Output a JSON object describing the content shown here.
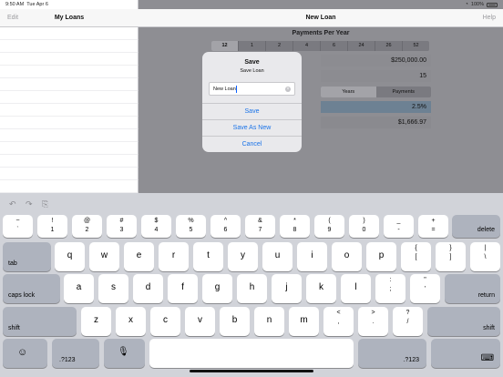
{
  "status_bar": {
    "time": "9:50 AM",
    "date": "Tue Apr 6",
    "battery": "100%"
  },
  "master": {
    "edit": "Edit",
    "title": "My Loans"
  },
  "detail": {
    "title": "New Loan",
    "help": "Help",
    "payments_per_year_label": "Payments Per Year",
    "payments_per_year_options": [
      "12",
      "1",
      "2",
      "4",
      "6",
      "24",
      "26",
      "52"
    ],
    "payments_per_year_selected": "12",
    "loan_amount": "$250,000.00",
    "term": "15",
    "term_units": [
      "Years",
      "Payments"
    ],
    "term_units_selected": "Years",
    "interest_rate": "2.5%",
    "payment": "$1,666.97"
  },
  "alert": {
    "title": "Save",
    "message": "Save Loan",
    "input_value": "New Loan",
    "buttons": {
      "save": "Save",
      "save_as_new": "Save As New",
      "cancel": "Cancel"
    }
  },
  "keyboard": {
    "row1": [
      {
        "t": "~",
        "b": "`"
      },
      {
        "t": "!",
        "b": "1"
      },
      {
        "t": "@",
        "b": "2"
      },
      {
        "t": "#",
        "b": "3"
      },
      {
        "t": "$",
        "b": "4"
      },
      {
        "t": "%",
        "b": "5"
      },
      {
        "t": "^",
        "b": "6"
      },
      {
        "t": "&",
        "b": "7"
      },
      {
        "t": "*",
        "b": "8"
      },
      {
        "t": "(",
        "b": "9"
      },
      {
        "t": ")",
        "b": "0"
      },
      {
        "t": "_",
        "b": "-"
      },
      {
        "t": "+",
        "b": "="
      }
    ],
    "delete": "delete",
    "tab": "tab",
    "row2": [
      "q",
      "w",
      "e",
      "r",
      "t",
      "y",
      "u",
      "i",
      "o",
      "p"
    ],
    "row2_pairs": [
      {
        "t": "{",
        "b": "["
      },
      {
        "t": "}",
        "b": "]"
      },
      {
        "t": "|",
        "b": "\\"
      }
    ],
    "caps_lock": "caps lock",
    "row3": [
      "a",
      "s",
      "d",
      "f",
      "g",
      "h",
      "j",
      "k",
      "l"
    ],
    "row3_pairs": [
      {
        "t": ":",
        "b": ";"
      },
      {
        "t": "\"",
        "b": "'"
      }
    ],
    "return": "return",
    "shift": "shift",
    "row4": [
      "z",
      "x",
      "c",
      "v",
      "b",
      "n",
      "m"
    ],
    "row4_pairs": [
      {
        "t": "<",
        "b": ","
      },
      {
        "t": ">",
        "b": "."
      },
      {
        "t": "?",
        "b": "/"
      }
    ],
    "numbers": ".?123"
  }
}
